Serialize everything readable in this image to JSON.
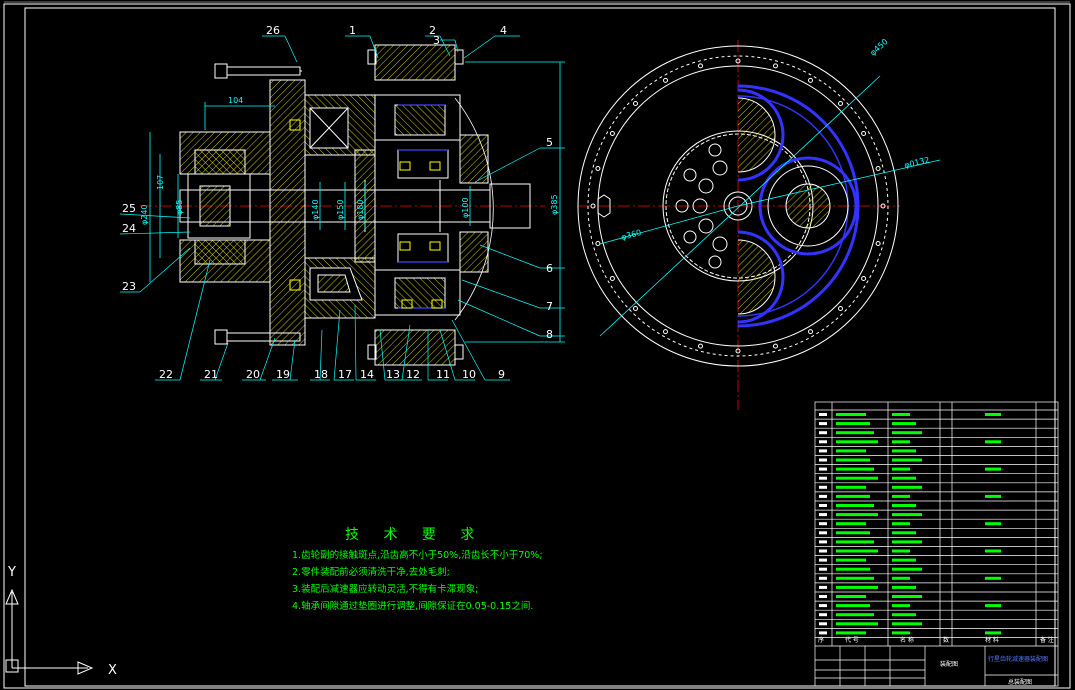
{
  "part_numbers": [
    "1",
    "2",
    "3",
    "4",
    "5",
    "6",
    "7",
    "8",
    "9",
    "10",
    "11",
    "12",
    "13",
    "14",
    "17",
    "18",
    "19",
    "20",
    "21",
    "22",
    "23",
    "24",
    "25",
    "26"
  ],
  "dimensions": {
    "d104": "104",
    "d450": "φ450",
    "d132": "φ0132",
    "d360": "φ360",
    "d385": "φ385",
    "d140": "φ140",
    "d150": "φ150",
    "d180": "φ180",
    "d85": "φ85",
    "d100": "φ100",
    "d107": "107",
    "d240": "φ240"
  },
  "requirements": {
    "title": "技 术 要 求",
    "items": [
      "1.齿轮副的接触斑点,沿齿高不小于50%,沿齿长不小于70%;",
      "2.零件装配前必须清洗干净,去处毛刺;",
      "3.装配后减速器应转动灵活,不得有卡滞现象;",
      "4.轴承间隙通过垫圈进行调整,间隙保证在0.05-0.15之间."
    ]
  },
  "title_block": {
    "header": [
      "序",
      "代 号",
      "名 称",
      "数",
      "材 料",
      "备 注"
    ],
    "name_cell": "行星齿轮减速器装配图",
    "drawing_cell": "装配图",
    "footer_cell": "总装配图"
  },
  "ucs": {
    "x_label": "X",
    "y_label": "Y"
  },
  "colors": {
    "background": "#000000",
    "outline": "#ffffff",
    "centerline": "#ff0000",
    "dimension": "#00ffff",
    "hatch": "#ffff00",
    "gear": "#3333ff",
    "text": "#00ff00",
    "leader": "#00ffff"
  }
}
